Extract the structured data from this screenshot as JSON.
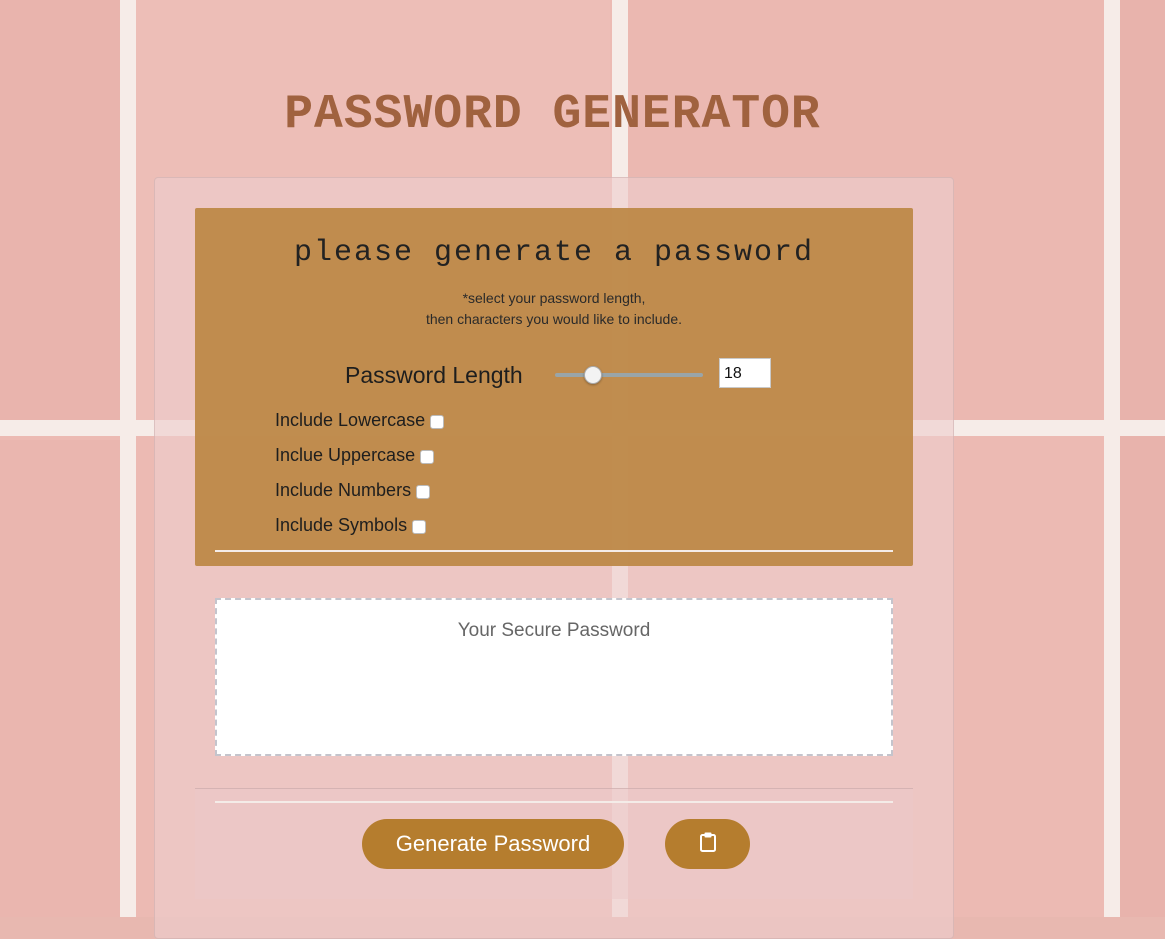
{
  "app": {
    "title": "PASSWORD GENERATOR"
  },
  "card": {
    "heading": "please generate a password",
    "instructions": {
      "line1": "*select your password length,",
      "line2": "then characters you would like to include."
    },
    "length": {
      "label": "Password Length",
      "value": "18",
      "slider_fraction": 0.18
    },
    "options": [
      {
        "label": "Include Lowercase",
        "checked": false
      },
      {
        "label": "Inclue Uppercase",
        "checked": false
      },
      {
        "label": "Include Numbers",
        "checked": false
      },
      {
        "label": "Include Symbols",
        "checked": false
      }
    ],
    "output": {
      "placeholder": "Your Secure Password"
    },
    "buttons": {
      "generate": "Generate Password",
      "copy_icon": "clipboard-icon"
    }
  },
  "colors": {
    "title": "#a0623f",
    "header_bg": "#be8a4a",
    "button_bg": "#b57d2e",
    "background": "#ecbab3"
  }
}
